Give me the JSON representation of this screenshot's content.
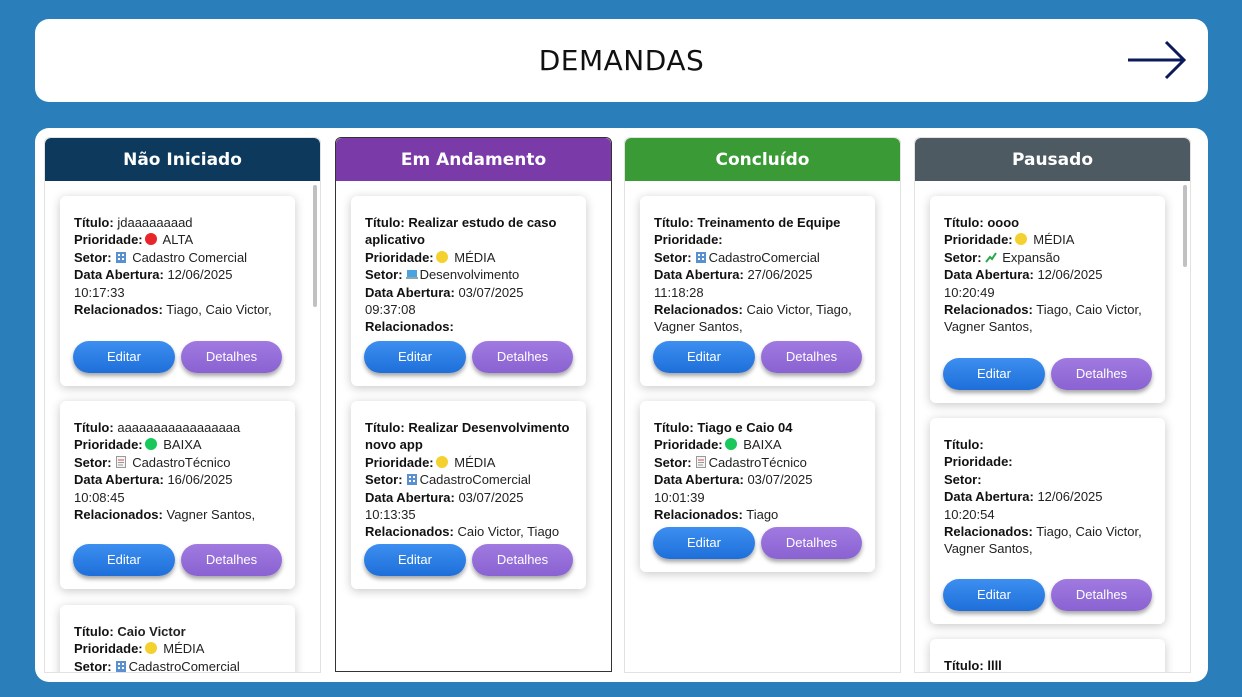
{
  "header": {
    "title": "DEMANDAS",
    "arrow_icon": "arrow-right-icon"
  },
  "labels": {
    "titulo": "Título:",
    "prioridade": "Prioridade:",
    "setor": "Setor:",
    "data_abertura": "Data Abertura:",
    "relacionados": "Relacionados:",
    "editar": "Editar",
    "detalhes": "Detalhes"
  },
  "colors": {
    "alta": "#e8262a",
    "media": "#f5d130",
    "baixa": "#18c85a",
    "nao_iniciado": "#0d3a5c",
    "em_andamento": "#7a3aa8",
    "concluido": "#3a9a35",
    "pausado": "#4d5a61"
  },
  "columns": [
    {
      "title": "Não Iniciado",
      "cards": [
        {
          "titulo": "jdaaaaaaaad",
          "prioridade": "ALTA",
          "setor": "Cadastro Comercial",
          "setor_icon": "building-icon",
          "data": "12/06/2025 10:17:33",
          "relacionados": "Tiago, Caio Victor,"
        },
        {
          "titulo": "aaaaaaaaaaaaaaaaa",
          "prioridade": "BAIXA",
          "setor": "CadastroTécnico",
          "setor_icon": "document-icon",
          "data": "16/06/2025 10:08:45",
          "relacionados": "Vagner Santos,"
        },
        {
          "titulo": "Caio Victor",
          "prioridade": "MÉDIA",
          "setor": "CadastroComercial",
          "setor_icon": "building-icon"
        }
      ]
    },
    {
      "title": "Em Andamento",
      "cards": [
        {
          "titulo": "Realizar estudo de caso aplicativo",
          "prioridade": "MÉDIA",
          "setor": "Desenvolvimento",
          "setor_icon": "laptop-icon",
          "data": "03/07/2025 09:37:08",
          "relacionados": ""
        },
        {
          "titulo": "Realizar Desenvolvimento novo app",
          "prioridade": "MÉDIA",
          "setor": "CadastroComercial",
          "setor_icon": "building-icon",
          "data": "03/07/2025 10:13:35",
          "relacionados": "Caio Victor, Tiago"
        }
      ]
    },
    {
      "title": "Concluído",
      "cards": [
        {
          "titulo": "Treinamento de Equipe",
          "prioridade": "",
          "setor": "CadastroComercial",
          "setor_icon": "building-icon",
          "data": "27/06/2025 11:18:28",
          "relacionados": "Caio Victor, Tiago, Vagner Santos,"
        },
        {
          "titulo": "Tiago e Caio 04",
          "prioridade": "BAIXA",
          "setor": "CadastroTécnico",
          "setor_icon": "document-icon",
          "data": "03/07/2025 10:01:39",
          "relacionados": "Tiago"
        }
      ]
    },
    {
      "title": "Pausado",
      "cards": [
        {
          "titulo": "oooo",
          "prioridade": "MÉDIA",
          "setor": "Expansão",
          "setor_icon": "chart-up-icon",
          "data": "12/06/2025 10:20:49",
          "relacionados": "Tiago, Caio Victor, Vagner Santos,"
        },
        {
          "titulo": "",
          "prioridade": "",
          "setor": "",
          "data": "12/06/2025 10:20:54",
          "relacionados": "Tiago, Caio Victor, Vagner Santos,"
        },
        {
          "titulo": "llll"
        }
      ]
    }
  ]
}
